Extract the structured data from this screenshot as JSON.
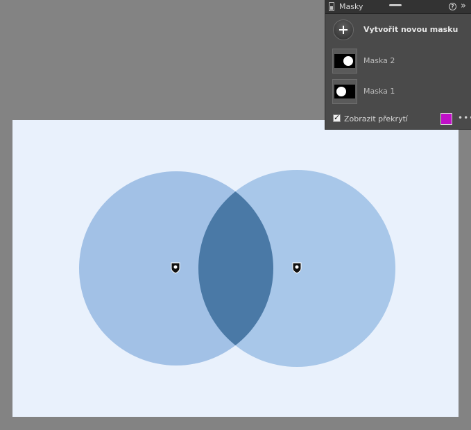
{
  "panel": {
    "title": "Masky",
    "new_mask_label": "Vytvořit novou masku",
    "masks": [
      {
        "label": "Maska 2",
        "dot_position": "right"
      },
      {
        "label": "Maska 1",
        "dot_position": "left"
      }
    ],
    "overlay": {
      "label": "Zobrazit překrytí",
      "checked": true,
      "color": "#c010c8"
    }
  },
  "canvas": {
    "background": "#e9f1fc",
    "circle_color": "#9ebfe5",
    "overlap_color": "#4a79a6"
  }
}
